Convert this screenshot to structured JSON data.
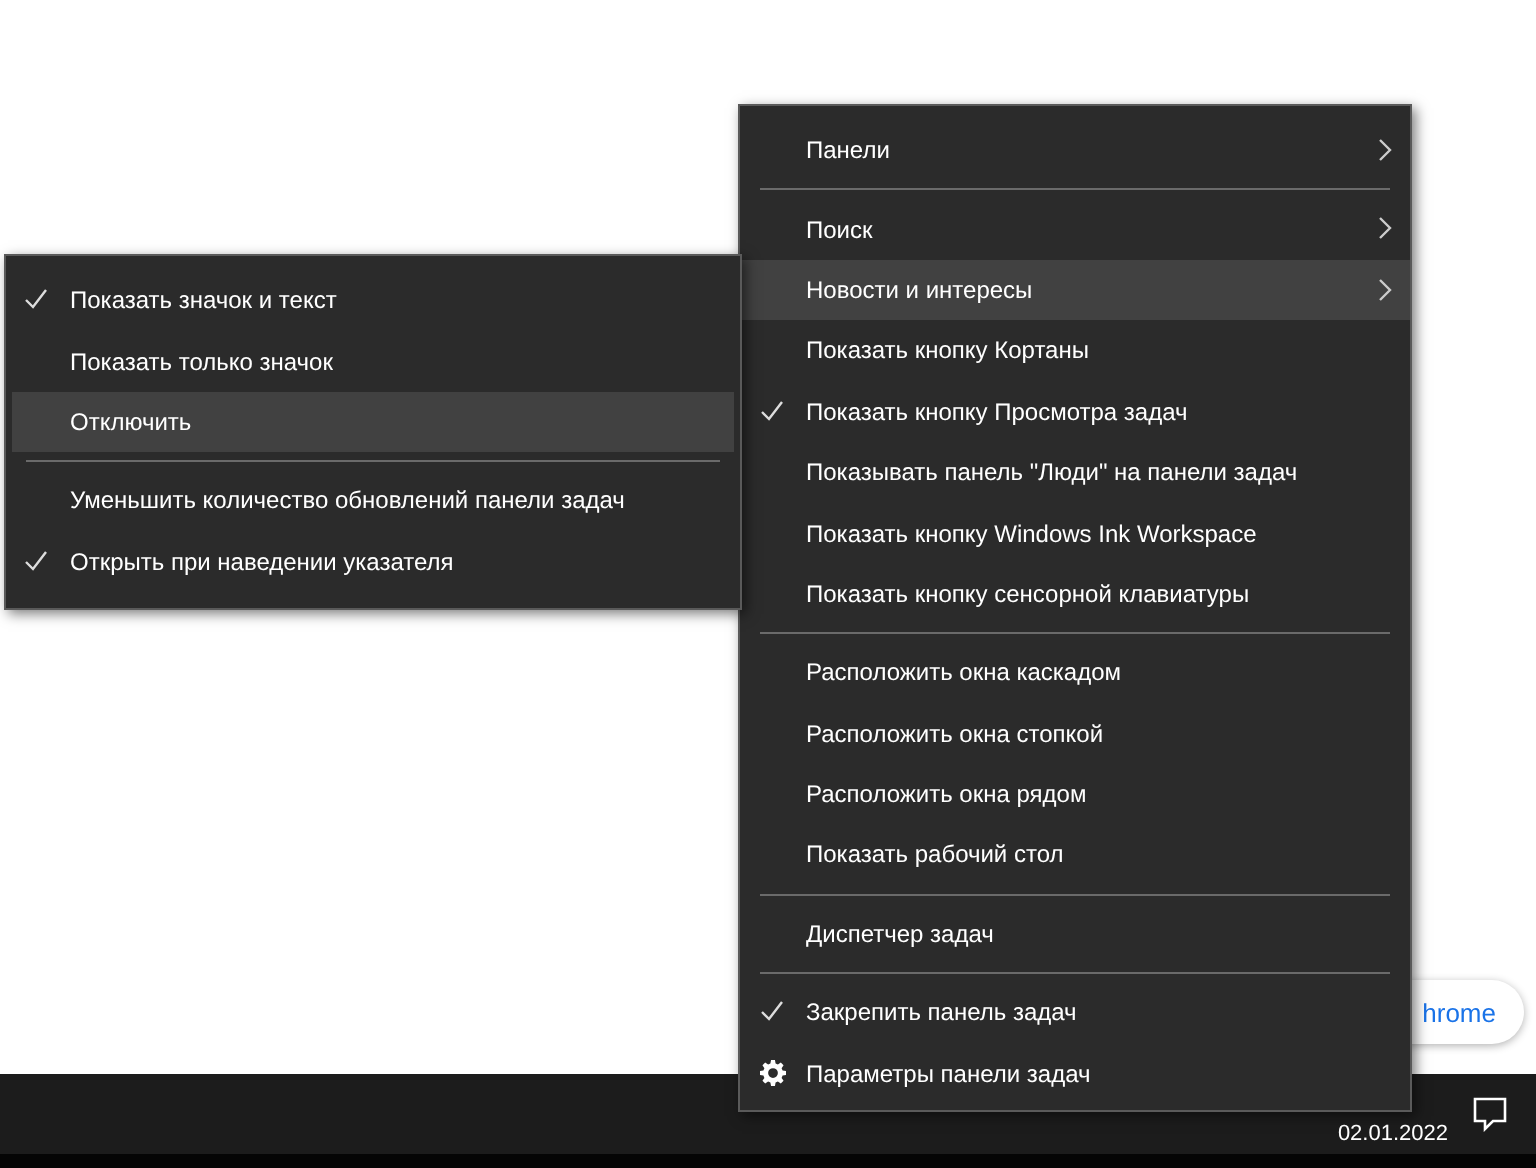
{
  "chip": {
    "label": "hrome"
  },
  "taskbar": {
    "date": "02.01.2022"
  },
  "main_menu": {
    "items": [
      {
        "kind": "item",
        "label": "Панели",
        "submenu": true,
        "checked": false,
        "selected": false
      },
      {
        "kind": "separator"
      },
      {
        "kind": "item",
        "label": "Поиск",
        "submenu": true,
        "checked": false,
        "selected": false
      },
      {
        "kind": "item",
        "label": "Новости и интересы",
        "submenu": true,
        "checked": false,
        "selected": true
      },
      {
        "kind": "item",
        "label": "Показать кнопку Кортаны",
        "submenu": false,
        "checked": false,
        "selected": false
      },
      {
        "kind": "item",
        "label": "Показать кнопку Просмотра задач",
        "submenu": false,
        "checked": true,
        "selected": false
      },
      {
        "kind": "item",
        "label": "Показывать панель \"Люди\" на панели задач",
        "submenu": false,
        "checked": false,
        "selected": false
      },
      {
        "kind": "item",
        "label": "Показать кнопку Windows Ink Workspace",
        "submenu": false,
        "checked": false,
        "selected": false
      },
      {
        "kind": "item",
        "label": "Показать кнопку сенсорной клавиатуры",
        "submenu": false,
        "checked": false,
        "selected": false
      },
      {
        "kind": "separator"
      },
      {
        "kind": "item",
        "label": "Расположить окна каскадом",
        "submenu": false,
        "checked": false,
        "selected": false
      },
      {
        "kind": "item",
        "label": "Расположить окна стопкой",
        "submenu": false,
        "checked": false,
        "selected": false
      },
      {
        "kind": "item",
        "label": "Расположить окна рядом",
        "submenu": false,
        "checked": false,
        "selected": false
      },
      {
        "kind": "item",
        "label": "Показать рабочий стол",
        "submenu": false,
        "checked": false,
        "selected": false
      },
      {
        "kind": "separator"
      },
      {
        "kind": "item",
        "label": "Диспетчер задач",
        "submenu": false,
        "checked": false,
        "selected": false
      },
      {
        "kind": "separator"
      },
      {
        "kind": "item",
        "label": "Закрепить панель задач",
        "submenu": false,
        "checked": true,
        "selected": false
      },
      {
        "kind": "settings",
        "label": "Параметры панели задач",
        "submenu": false,
        "selected": false
      }
    ]
  },
  "submenu": {
    "items": [
      {
        "kind": "item",
        "label": "Показать значок и текст",
        "submenu": false,
        "checked": true,
        "selected": false
      },
      {
        "kind": "item",
        "label": "Показать только значок",
        "submenu": false,
        "checked": false,
        "selected": false
      },
      {
        "kind": "item",
        "label": "Отключить",
        "submenu": false,
        "checked": false,
        "selected": true
      },
      {
        "kind": "separator"
      },
      {
        "kind": "item",
        "label": "Уменьшить количество обновлений панели задач",
        "submenu": false,
        "checked": false,
        "selected": false
      },
      {
        "kind": "item",
        "label": "Открыть при наведении указателя",
        "submenu": false,
        "checked": true,
        "selected": false
      }
    ]
  }
}
